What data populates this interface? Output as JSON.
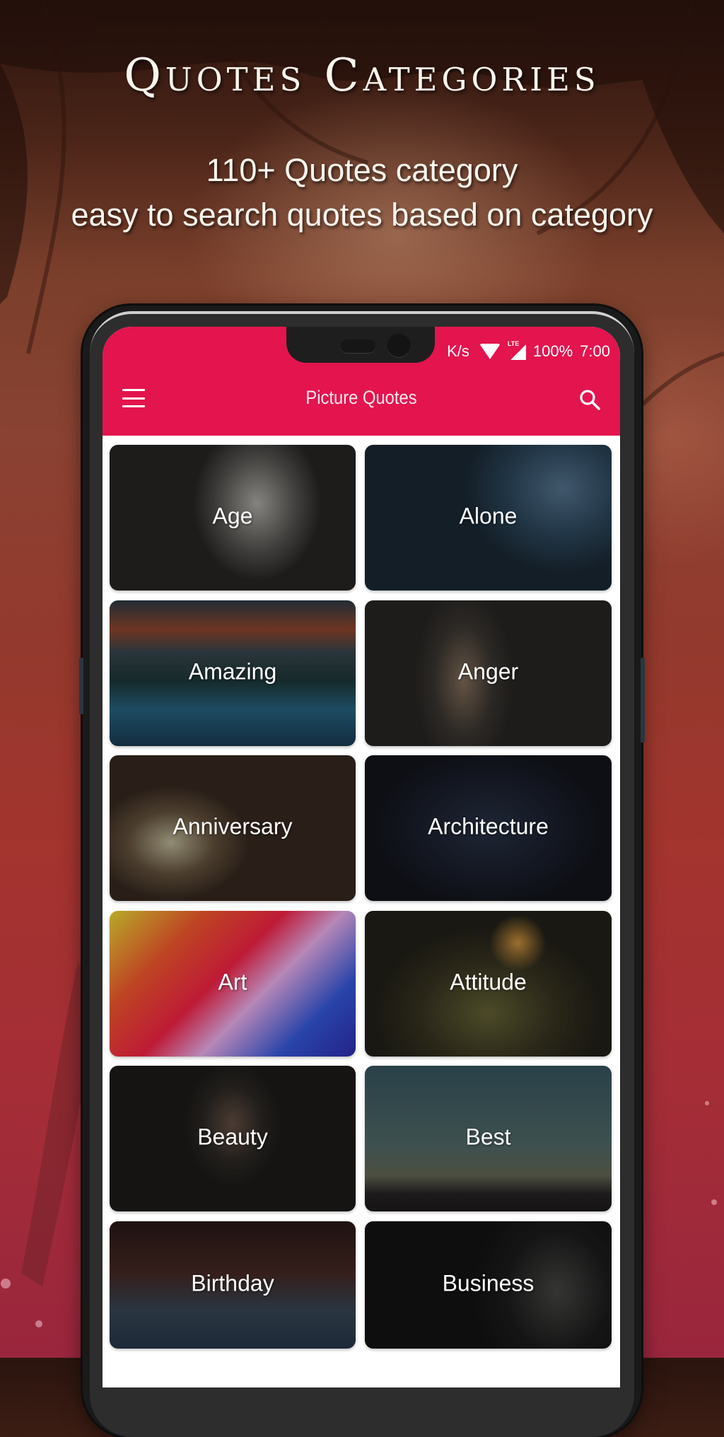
{
  "hero": {
    "title": "Quotes Categories",
    "subtitle_line1": "110+ Quotes category",
    "subtitle_line2": "easy to search  quotes based on category"
  },
  "status_bar": {
    "network_speed": "K/s",
    "network_type": "LTE",
    "battery": "100%",
    "time": "7:00"
  },
  "app_bar": {
    "title": "Picture Quotes",
    "menu_icon": "hamburger-menu-icon",
    "search_icon": "search-icon",
    "color": "#e3144e"
  },
  "categories": [
    {
      "label": "Age"
    },
    {
      "label": "Alone"
    },
    {
      "label": "Amazing"
    },
    {
      "label": "Anger"
    },
    {
      "label": "Anniversary"
    },
    {
      "label": "Architecture"
    },
    {
      "label": "Art"
    },
    {
      "label": "Attitude"
    },
    {
      "label": "Beauty"
    },
    {
      "label": "Best"
    },
    {
      "label": "Birthday"
    },
    {
      "label": "Business"
    }
  ]
}
